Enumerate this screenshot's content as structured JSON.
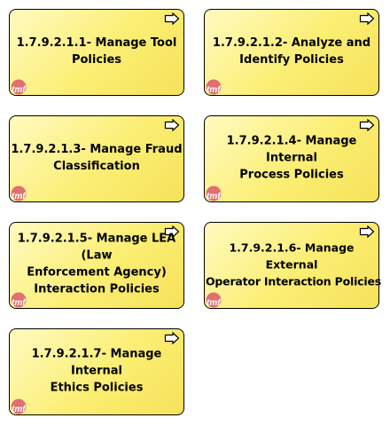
{
  "processes": [
    {
      "label_line1": "1.7.9.2.1.1- Manage Tool",
      "label_line2": "Policies",
      "label_line3": ""
    },
    {
      "label_line1": "1.7.9.2.1.2- Analyze and",
      "label_line2": "Identify Policies",
      "label_line3": ""
    },
    {
      "label_line1": "1.7.9.2.1.3- Manage Fraud",
      "label_line2": "Classification",
      "label_line3": ""
    },
    {
      "label_line1": "1.7.9.2.1.4- Manage Internal",
      "label_line2": "Process Policies",
      "label_line3": ""
    },
    {
      "label_line1": "1.7.9.2.1.5- Manage LEA (Law",
      "label_line2": "Enforcement Agency)",
      "label_line3": "Interaction Policies"
    },
    {
      "label_line1": "1.7.9.2.1.6- Manage External",
      "label_line2": "Operator Interaction Policies",
      "label_line3": ""
    },
    {
      "label_line1": "1.7.9.2.1.7- Manage Internal",
      "label_line2": "Ethics Policies",
      "label_line3": ""
    }
  ],
  "icons": {
    "process": "process-arrow-icon",
    "logo": "tmf-logo-icon",
    "logo_text": "tmf"
  },
  "colors": {
    "box_fill": "#fbee73",
    "box_border": "#000000",
    "logo_circle": "#e07070",
    "logo_text": "#ffffff"
  }
}
